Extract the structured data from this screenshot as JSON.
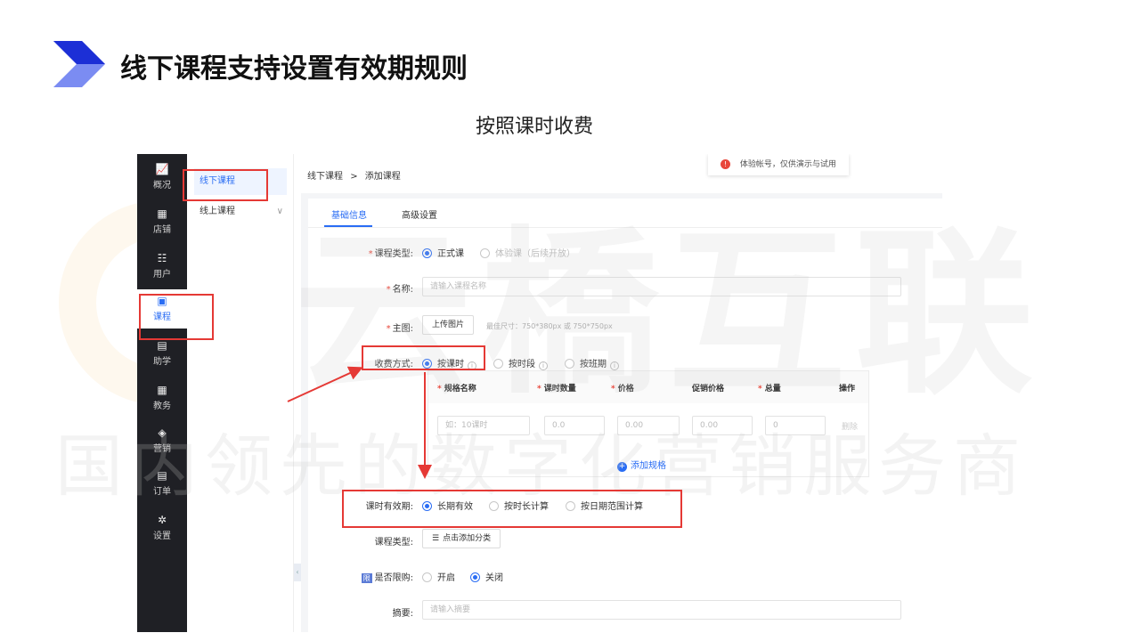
{
  "slide": {
    "title": "线下课程支持设置有效期规则",
    "subtitle": "按照课时收费",
    "watermark_big": "云橋互联",
    "watermark_small": "国内领先的数字化营销服务商"
  },
  "colors": {
    "accent_blue": "#2a6df4",
    "logo_dark": "#1c2fd6",
    "logo_light": "#7b8cf2",
    "annotation_red": "#e53935"
  },
  "sidenav": {
    "items": [
      {
        "label": "概况",
        "icon": "chart-icon",
        "glyph": "📈"
      },
      {
        "label": "店铺",
        "icon": "store-icon",
        "glyph": "▦"
      },
      {
        "label": "用户",
        "icon": "users-icon",
        "glyph": "☷"
      },
      {
        "label": "课程",
        "icon": "course-icon",
        "glyph": "▣"
      },
      {
        "label": "助学",
        "icon": "gamepad-icon",
        "glyph": "▤"
      },
      {
        "label": "教务",
        "icon": "calendar-icon",
        "glyph": "▦"
      },
      {
        "label": "营销",
        "icon": "tag-icon",
        "glyph": "◈"
      },
      {
        "label": "订单",
        "icon": "document-icon",
        "glyph": "▤"
      },
      {
        "label": "设置",
        "icon": "gear-icon",
        "glyph": "✲"
      }
    ]
  },
  "subnav": {
    "items": [
      "线下课程",
      "线上课程"
    ],
    "chevron": "∨"
  },
  "breadcrumb": {
    "parent": "线下课程",
    "separator": ">",
    "current": "添加课程"
  },
  "notice": {
    "icon_glyph": "!",
    "text": "体验帐号，仅供演示与试用"
  },
  "tabs": [
    "基础信息",
    "高级设置"
  ],
  "form": {
    "course_type": {
      "label": "课程类型:",
      "options": [
        "正式课",
        "体验课（后续开放）"
      ]
    },
    "name": {
      "label": "名称:",
      "placeholder": "请输入课程名称"
    },
    "cover": {
      "label": "主图:",
      "button": "上传图片",
      "hint": "最佳尺寸：750*380px 或 750*750px"
    },
    "charge": {
      "label": "收费方式:",
      "options": [
        "按课时",
        "按时段",
        "按班期"
      ],
      "info_glyph": "i"
    },
    "spec_table": {
      "headers": [
        "规格名称",
        "课时数量",
        "价格",
        "促销价格",
        "总量",
        "操作"
      ],
      "row": {
        "name_placeholder": "如：10课时",
        "hours": "0.0",
        "price": "0.00",
        "promo": "0.00",
        "total": "0",
        "delete": "删除"
      },
      "add_label": "添加规格",
      "add_glyph": "+"
    },
    "validity": {
      "label": "课时有效期:",
      "options": [
        "长期有效",
        "按时长计算",
        "按日期范围计算"
      ]
    },
    "category": {
      "label": "课程类型:",
      "button": "点击添加分类",
      "button_glyph": "☰"
    },
    "limit": {
      "label": "是否限购:",
      "badge": "限",
      "options": [
        "开启",
        "关闭"
      ]
    },
    "summary": {
      "label": "摘要:",
      "placeholder": "请输入摘要"
    }
  },
  "collapse_glyph": "‹"
}
